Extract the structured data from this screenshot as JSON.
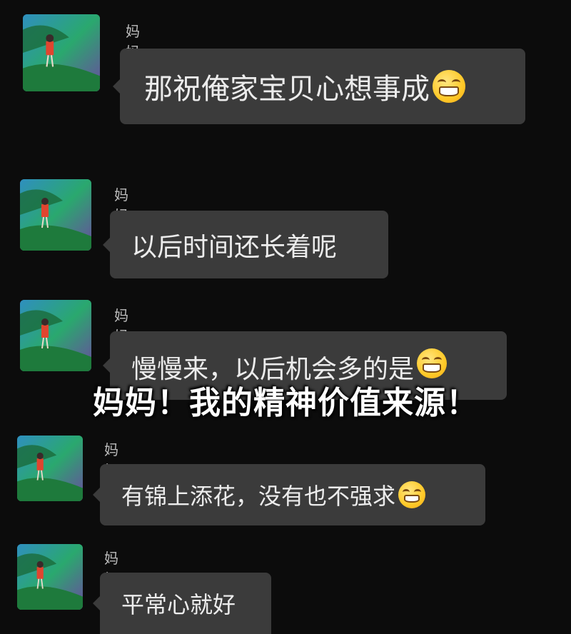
{
  "messages": [
    {
      "sender": "妈妈",
      "text": "那祝俺家宝贝心想事成",
      "emoji": "grinning-emoji"
    },
    {
      "sender": "妈妈",
      "text": "以后时间还长着呢",
      "emoji": ""
    },
    {
      "sender": "妈妈",
      "text": "慢慢来，以后机会多的是",
      "emoji": "grinning-emoji"
    },
    {
      "sender": "妈妈",
      "text": "有锦上添花，没有也不强求",
      "emoji": "grinning-emoji"
    },
    {
      "sender": "妈妈",
      "text": "平常心就好",
      "emoji": ""
    }
  ],
  "overlay_caption": "妈妈！我的精神价值来源！",
  "colors": {
    "background": "#0c0c0c",
    "bubble": "#3b3b3b",
    "sender_text": "#bdbdbd",
    "overlay_text": "#ffffff"
  }
}
